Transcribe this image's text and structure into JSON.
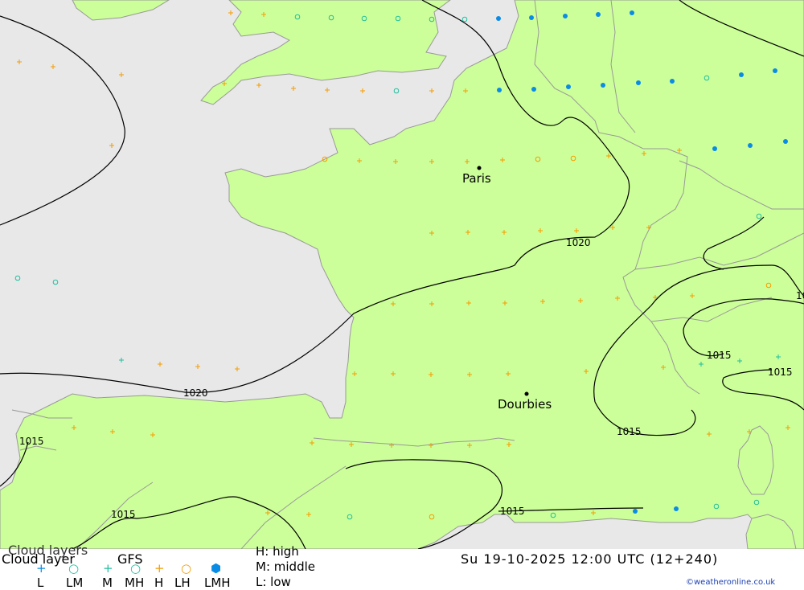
{
  "colors": {
    "land": "#ccff99",
    "sea": "#e8e8e8",
    "border": "#999999",
    "isobar": "#000000",
    "low": "#f59c00",
    "middle": "#1fbf9f",
    "high": "#0a8ce6"
  },
  "legend": {
    "title": "Cloud layer",
    "title_shadow": "Cloud layers",
    "model": "GFS",
    "symbols": [
      "L",
      "LM",
      "M",
      "MH",
      "H",
      "LH",
      "LMH"
    ],
    "key_high": "H: high",
    "key_middle": "M: middle",
    "key_low": "L: low",
    "datetime": "Su 19-10-2025 12:00 UTC (12+240)",
    "credit": "©weatheronline.co.uk"
  },
  "map": {
    "cities": [
      {
        "name": "Paris"
      },
      {
        "name": "Dourbies"
      }
    ],
    "isobar_labels": [
      "1020",
      "1020",
      "1015",
      "1015",
      "1015",
      "1015",
      "1015",
      "1015",
      "10"
    ]
  }
}
